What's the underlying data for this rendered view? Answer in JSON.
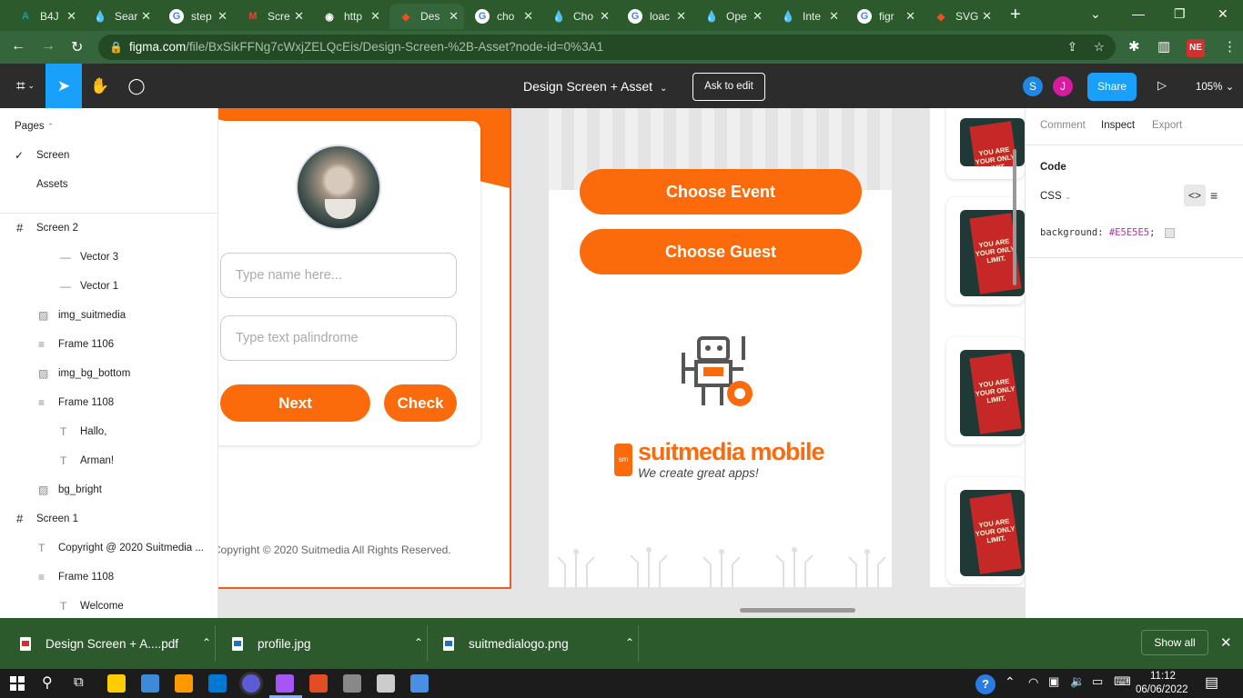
{
  "browser": {
    "tabs": [
      {
        "label": "B4J",
        "favicon": "A",
        "color": "#19a3a3"
      },
      {
        "label": "Sear",
        "favicon": "drop",
        "color": "#2a9df4"
      },
      {
        "label": "step",
        "favicon": "G",
        "color": "#ffffff"
      },
      {
        "label": "Scre",
        "favicon": "M",
        "color": "#ea4335"
      },
      {
        "label": "http",
        "favicon": "globe",
        "color": "#cccccc"
      },
      {
        "label": "Des",
        "favicon": "F",
        "color": "#f24e1e"
      },
      {
        "label": "cho",
        "favicon": "G",
        "color": "#ffffff"
      },
      {
        "label": "Cho",
        "favicon": "drop",
        "color": "#2a9df4"
      },
      {
        "label": "loac",
        "favicon": "G",
        "color": "#ffffff"
      },
      {
        "label": "Ope",
        "favicon": "drop",
        "color": "#2a9df4"
      },
      {
        "label": "Inte",
        "favicon": "drop",
        "color": "#2a9df4"
      },
      {
        "label": "figr",
        "favicon": "G",
        "color": "#ffffff"
      },
      {
        "label": "SVG",
        "favicon": "F",
        "color": "#f24e1e"
      }
    ],
    "url_host": "figma.com",
    "url_path": "/file/BxSikFFNg7cWxjZELQcEis/Design-Screen-%2B-Asset?node-id=0%3A1",
    "ext_badge": "NE"
  },
  "figma": {
    "doc_title": "Design Screen + Asset",
    "ask_to_edit": "Ask to edit",
    "avatars": [
      {
        "letter": "S",
        "color": "#1e88e5"
      },
      {
        "letter": "J",
        "color": "#d81b9e"
      }
    ],
    "share": "Share",
    "zoom": "105%"
  },
  "layers": {
    "pages_label": "Pages",
    "pages": [
      {
        "label": "Screen",
        "checked": true
      },
      {
        "label": "Assets",
        "checked": false
      }
    ],
    "items": [
      {
        "label": "Screen 2",
        "icon": "#",
        "indent": 0
      },
      {
        "label": "Vector 3",
        "icon": "—",
        "indent": 2
      },
      {
        "label": "Vector 1",
        "icon": "—",
        "indent": 2
      },
      {
        "label": "img_suitmedia",
        "icon": "▨",
        "indent": 1
      },
      {
        "label": "Frame 1106",
        "icon": "≡",
        "indent": 1
      },
      {
        "label": "img_bg_bottom",
        "icon": "▨",
        "indent": 1
      },
      {
        "label": "Frame 1108",
        "icon": "≡",
        "indent": 1
      },
      {
        "label": "Hallo,",
        "icon": "T",
        "indent": 2
      },
      {
        "label": "Arman!",
        "icon": "T",
        "indent": 2
      },
      {
        "label": "bg_bright",
        "icon": "▨",
        "indent": 1
      },
      {
        "label": "Screen 1",
        "icon": "#",
        "indent": 0
      },
      {
        "label": "Copyright @ 2020 Suitmedia ...",
        "icon": "T",
        "indent": 1
      },
      {
        "label": "Frame 1108",
        "icon": "≡",
        "indent": 1
      },
      {
        "label": "Welcome",
        "icon": "T",
        "indent": 2
      }
    ]
  },
  "canvas": {
    "screen1": {
      "name_placeholder": "Type name here...",
      "palindrome_placeholder": "Type text palindrome",
      "next": "Next",
      "check": "Check",
      "copyright": "Copyright © 2020 Suitmedia All Rights Reserved."
    },
    "screen2": {
      "choose_event": "Choose Event",
      "choose_guest": "Choose Guest",
      "brand_name": "suitmedia mobile",
      "brand_tagline": "We create great apps!",
      "brand_badge": "sm"
    },
    "book_text": "YOU ARE YOUR ONLY LIMIT.",
    "accent": "#fb6b0c"
  },
  "inspect": {
    "tabs": [
      "Comment",
      "Inspect",
      "Export"
    ],
    "active_tab": "Inspect",
    "code_label": "Code",
    "lang": "CSS",
    "css_property": "background",
    "css_value": "#E5E5E5",
    "css_color": "#e5e5e5"
  },
  "downloads": {
    "items": [
      "Design Screen + A....pdf",
      "profile.jpg",
      "suitmedialogo.png"
    ],
    "show_all": "Show all"
  },
  "taskbar": {
    "time": "11:12",
    "date": "06/06/2022",
    "icon_colors": [
      "#ffcc00",
      "#3c8ad8",
      "#ff9900",
      "#0078d4",
      "#5b5bd6",
      "#a855f7",
      "#e34d26",
      "#888888",
      "#cccccc",
      "#4a90e2",
      "#2bb24c",
      "#8e44ad"
    ]
  }
}
